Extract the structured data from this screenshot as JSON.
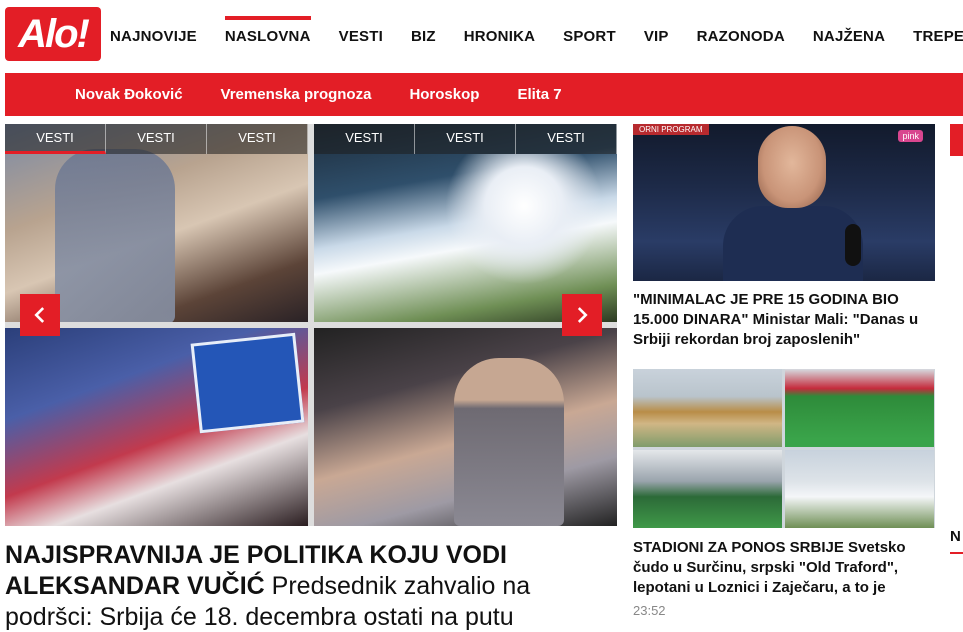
{
  "brand": {
    "logo_text": "Alo!",
    "color": "#e31e26"
  },
  "main_nav": {
    "items": [
      {
        "label": "NAJNOVIJE"
      },
      {
        "label": "NASLOVNA",
        "active": true
      },
      {
        "label": "VESTI"
      },
      {
        "label": "BIZ"
      },
      {
        "label": "HRONIKA"
      },
      {
        "label": "SPORT"
      },
      {
        "label": "VIP"
      },
      {
        "label": "RAZONODA"
      },
      {
        "label": "NAJŽENA"
      },
      {
        "label": "TREPEZA"
      }
    ]
  },
  "sub_nav": {
    "items": [
      {
        "label": "Novak Đoković"
      },
      {
        "label": "Vremenska prognoza"
      },
      {
        "label": "Horoskop"
      },
      {
        "label": "Elita 7"
      }
    ]
  },
  "slider": {
    "left_tabs": [
      "VESTI",
      "VESTI",
      "VESTI"
    ],
    "right_tabs": [
      "VESTI",
      "VESTI",
      "VESTI"
    ],
    "active_tab": 0,
    "headline_kicker": "NAJISPRAVNIJA JE POLITIKA KOJU VODI ALEKSANDAR VUČIĆ",
    "headline_text": " Predsednik zahvalio na podršci: Srbija će 18. decembra ostati na putu"
  },
  "cards": [
    {
      "title": "\"MINIMALAC JE PRE 15 GODINA BIO 15.000 DINARA\" Ministar Mali: \"Danas u Srbiji rekordan broj zaposlenih\"",
      "image_badge": "pink",
      "image_program": "ORNI PROGRAM"
    },
    {
      "title": "STADIONI ZA PONOS SRBIJE Svetsko čudo u Surčinu, srpski \"Old Traford\", lepotani u Loznici i Zaječaru, a to je",
      "time": "23:52"
    }
  ],
  "edge": {
    "letter": "N"
  }
}
